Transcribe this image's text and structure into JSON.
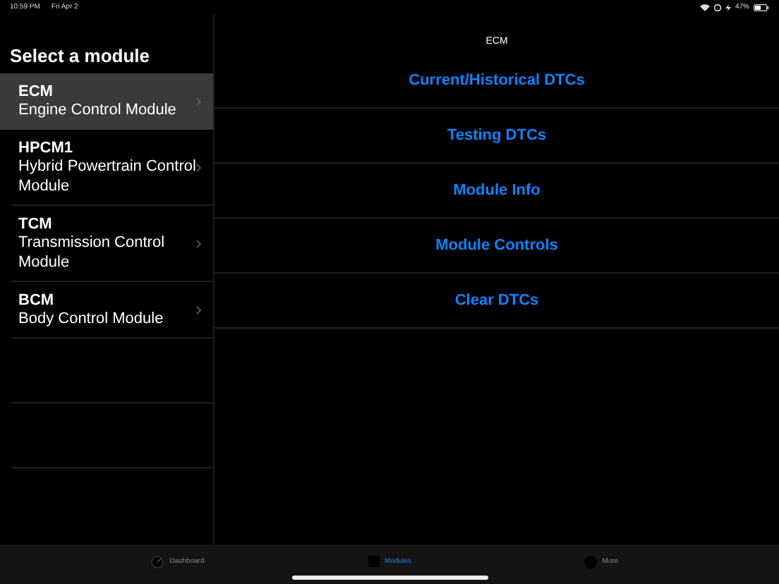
{
  "status_bar": {
    "time": "10:59 PM",
    "date": "Fri Apr 2",
    "battery": "47%"
  },
  "sidebar": {
    "title": "Select a module",
    "items": [
      {
        "code": "ECM",
        "name": "Engine Control Module",
        "selected": true
      },
      {
        "code": "HPCM1",
        "name": "Hybrid Powertrain Control Module",
        "selected": false
      },
      {
        "code": "TCM",
        "name": "Transmission Control Module",
        "selected": false
      },
      {
        "code": "BCM",
        "name": "Body Control Module",
        "selected": false
      }
    ]
  },
  "detail": {
    "title": "ECM",
    "actions": [
      "Current/Historical DTCs",
      "Testing DTCs",
      "Module Info",
      "Module Controls",
      "Clear DTCs"
    ]
  },
  "tab_bar": [
    {
      "label": "Dashboard",
      "kind": "gauge",
      "selected": false
    },
    {
      "label": "Modules",
      "kind": "square",
      "selected": true
    },
    {
      "label": "More",
      "kind": "circle",
      "selected": false
    }
  ]
}
